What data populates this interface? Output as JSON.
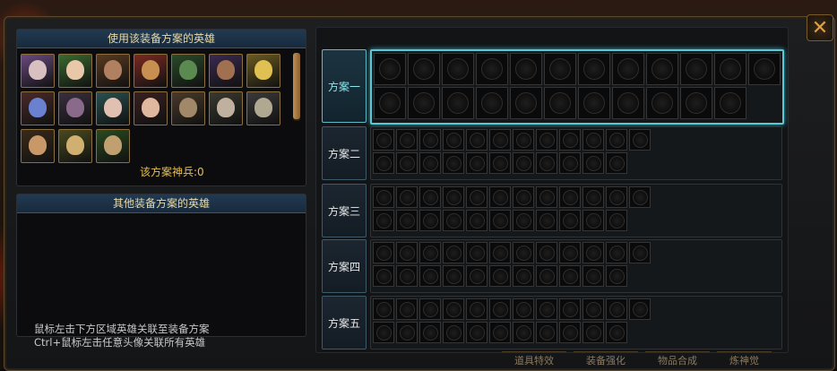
{
  "window": {
    "close_icon": "close-x-icon",
    "close_label": "✕"
  },
  "left": {
    "heroes_title": "使用该装备方案的英雄",
    "weapon_count": "该方案神兵:0",
    "other_title": "其他装备方案的英雄",
    "hint_line1": "鼠标左击下方区域英雄关联至装备方案",
    "hint_line2": "Ctrl+鼠标左击任意头像关联所有英雄",
    "heroes": [
      {
        "name": "hero-portrait-1",
        "bg": "#6a4a80",
        "face": "#d8c0c0"
      },
      {
        "name": "hero-portrait-2",
        "bg": "#3a6a30",
        "face": "#e8c8a8"
      },
      {
        "name": "hero-portrait-3",
        "bg": "#5a3a20",
        "face": "#b08060"
      },
      {
        "name": "hero-portrait-4",
        "bg": "#7a2a20",
        "face": "#c89050"
      },
      {
        "name": "hero-portrait-5",
        "bg": "#2a4a2a",
        "face": "#5a8a50"
      },
      {
        "name": "hero-portrait-6",
        "bg": "#3a2a50",
        "face": "#a07050"
      },
      {
        "name": "hero-portrait-7",
        "bg": "#6a5a20",
        "face": "#e0c050"
      },
      {
        "name": "hero-portrait-8",
        "bg": "#4a2a2a",
        "face": "#6a80d0"
      },
      {
        "name": "hero-portrait-9",
        "bg": "#3a3040",
        "face": "#8a6a8a"
      },
      {
        "name": "hero-portrait-10",
        "bg": "#2a5050",
        "face": "#e0c0b0"
      },
      {
        "name": "hero-portrait-11",
        "bg": "#3a2020",
        "face": "#e0b8a0"
      },
      {
        "name": "hero-portrait-12",
        "bg": "#4a3a2a",
        "face": "#a08868"
      },
      {
        "name": "hero-portrait-13",
        "bg": "#3a3a30",
        "face": "#c0b0a0"
      },
      {
        "name": "hero-portrait-14",
        "bg": "#3a3a3a",
        "face": "#b0a890"
      },
      {
        "name": "hero-portrait-15",
        "bg": "#3a2a1a",
        "face": "#c89868"
      },
      {
        "name": "hero-portrait-16",
        "bg": "#4a4a20",
        "face": "#d0b070"
      },
      {
        "name": "hero-portrait-17",
        "bg": "#2a4a20",
        "face": "#c0a070"
      }
    ]
  },
  "plans": [
    {
      "label": "方案一",
      "active": true,
      "row1": 12,
      "row2": 11
    },
    {
      "label": "方案二",
      "active": false,
      "row1": 12,
      "row2": 11
    },
    {
      "label": "方案三",
      "active": false,
      "row1": 12,
      "row2": 11
    },
    {
      "label": "方案四",
      "active": false,
      "row1": 12,
      "row2": 11
    },
    {
      "label": "方案五",
      "active": false,
      "row1": 12,
      "row2": 11
    }
  ],
  "bottom_tabs": [
    "道具特效",
    "装备强化",
    "物品合成",
    "炼神觉"
  ],
  "colors": {
    "accent": "#5cc8d4",
    "gold": "#e8c050"
  }
}
